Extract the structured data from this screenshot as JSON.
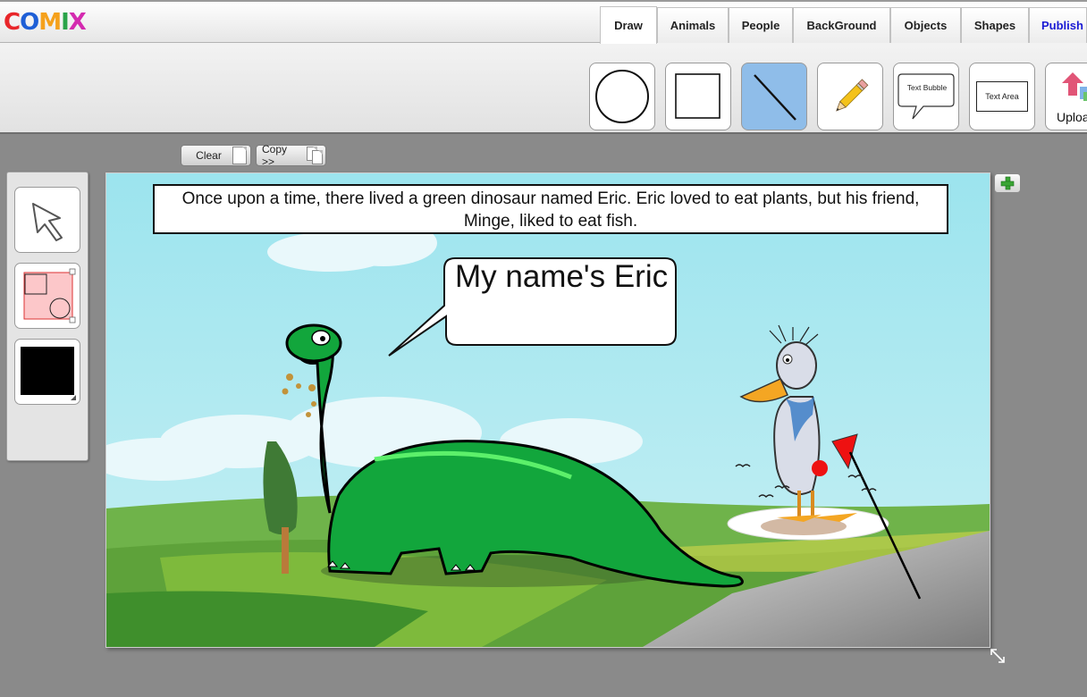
{
  "app": {
    "logo": [
      "C",
      "O",
      "M",
      "I",
      "X"
    ],
    "logo_colors": [
      "#e8262a",
      "#1e5fd6",
      "#f5a11b",
      "#2aa34a",
      "#d42bb0"
    ]
  },
  "tabs": [
    {
      "label": "Draw",
      "active": true
    },
    {
      "label": "Animals"
    },
    {
      "label": "People"
    },
    {
      "label": "BackGround"
    },
    {
      "label": "Objects"
    },
    {
      "label": "Shapes"
    },
    {
      "label": "Publish"
    }
  ],
  "toolbar": {
    "tools": [
      {
        "name": "circle-tool",
        "icon": "circle-icon"
      },
      {
        "name": "rectangle-tool",
        "icon": "square-icon"
      },
      {
        "name": "line-tool",
        "icon": "line-icon",
        "selected": true
      },
      {
        "name": "pencil-tool",
        "icon": "pencil-icon"
      },
      {
        "name": "text-bubble-tool",
        "label": "Text Bubble"
      },
      {
        "name": "text-area-tool",
        "label": "Text Area"
      },
      {
        "name": "upload-tool",
        "label": "Uploa"
      }
    ]
  },
  "edit_buttons": {
    "clear": "Clear",
    "copy": "Copy >>"
  },
  "left_panel": {
    "tools": [
      "pointer-icon",
      "fill-stroke-icon",
      "color-swatch"
    ],
    "swatch_color": "#000000"
  },
  "canvas": {
    "caption": "Once upon a time, there lived a green dinosaur named Eric. Eric loved to eat plants, but his friend, Minge, liked to eat fish.",
    "speech_bubble": "My name's Eric"
  },
  "colors": {
    "accent_selected": "#8fbde9",
    "publish": "#1a1ad4",
    "add_icon": "#3aa534"
  }
}
